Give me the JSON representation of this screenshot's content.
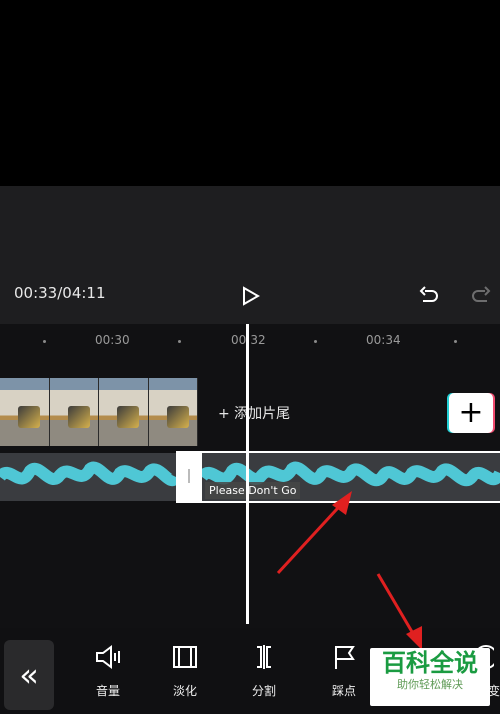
{
  "player": {
    "timecode": "00:33/04:11"
  },
  "ruler": {
    "labels": [
      "00:30",
      "00:32",
      "00:34"
    ]
  },
  "timeline": {
    "add_end_label": "+ 添加片尾",
    "audio_label": "Please Don't Go"
  },
  "toolbar": {
    "items": [
      {
        "label": "音量",
        "icon": "volume-icon"
      },
      {
        "label": "淡化",
        "icon": "fade-icon"
      },
      {
        "label": "分割",
        "icon": "split-icon"
      },
      {
        "label": "踩点",
        "icon": "beat-icon"
      }
    ],
    "partial_label": "变"
  },
  "watermark": {
    "title": "百科全说",
    "subtitle": "助你轻松解决"
  },
  "colors": {
    "accent": "#4fc7d5",
    "background": "#1e1e20",
    "arrow": "#e02020"
  }
}
